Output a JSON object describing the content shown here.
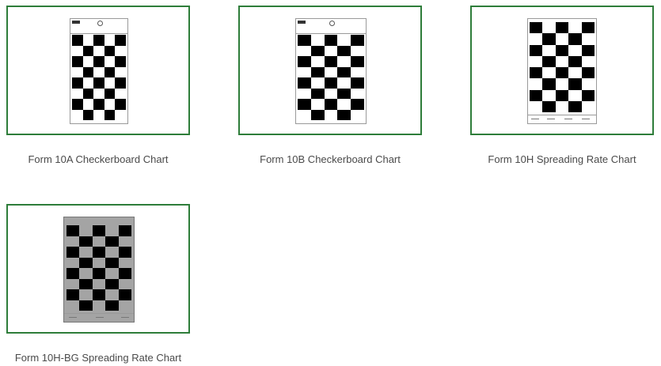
{
  "items": [
    {
      "label": "Form 10A Checkerboard Chart",
      "variant": "standard"
    },
    {
      "label": "Form 10B Checkerboard Chart",
      "variant": "standard"
    },
    {
      "label": "Form 10H Spreading Rate Chart",
      "variant": "spreading"
    },
    {
      "label": "Form 10H-BG Spreading Rate Chart",
      "variant": "gray-background"
    }
  ],
  "colors": {
    "card_border": "#2e7d3a",
    "caption_text": "#4a4a4a",
    "checker_dark": "#000000",
    "checker_light": "#ffffff",
    "checker_gray": "#a4a4a4"
  }
}
